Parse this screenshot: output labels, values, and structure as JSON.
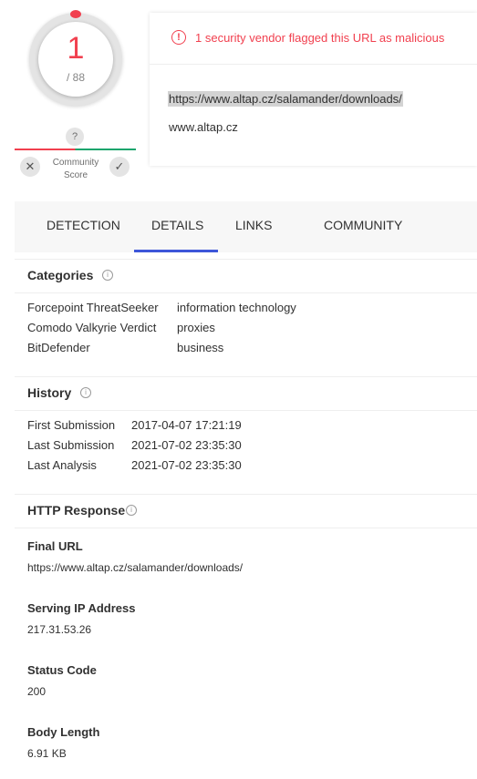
{
  "score": {
    "detections": "1",
    "total": "/ 88"
  },
  "community": {
    "unknown_symbol": "?",
    "label_line1": "Community",
    "label_line2": "Score",
    "vote_down_symbol": "✕",
    "vote_up_symbol": "✓"
  },
  "alert": {
    "icon_symbol": "!",
    "text": "1 security vendor flagged this URL as malicious"
  },
  "target": {
    "url": "https://www.altap.cz/salamander/downloads/",
    "domain": "www.altap.cz"
  },
  "tabs": [
    {
      "label": "DETECTION"
    },
    {
      "label": "DETAILS",
      "active": true
    },
    {
      "label": "LINKS"
    },
    {
      "label": "COMMUNITY"
    }
  ],
  "categories": {
    "title": "Categories",
    "rows": [
      {
        "vendor": "Forcepoint ThreatSeeker",
        "value": "information technology"
      },
      {
        "vendor": "Comodo Valkyrie Verdict",
        "value": "proxies"
      },
      {
        "vendor": "BitDefender",
        "value": "business"
      }
    ]
  },
  "history": {
    "title": "History",
    "rows": [
      {
        "label": "First Submission",
        "value": "2017-04-07 17:21:19"
      },
      {
        "label": "Last Submission",
        "value": "2021-07-02 23:35:30"
      },
      {
        "label": "Last Analysis",
        "value": "2021-07-02 23:35:30"
      }
    ]
  },
  "http_response": {
    "title": "HTTP Response",
    "fields": [
      {
        "label": "Final URL",
        "value": "https://www.altap.cz/salamander/downloads/"
      },
      {
        "label": "Serving IP Address",
        "value": "217.31.53.26"
      },
      {
        "label": "Status Code",
        "value": "200"
      },
      {
        "label": "Body Length",
        "value": "6.91 KB"
      }
    ]
  },
  "info_icon_symbol": "i",
  "colors": {
    "malicious": "#f1404f",
    "harmless": "#19a56d",
    "accent": "#3d56d9"
  }
}
